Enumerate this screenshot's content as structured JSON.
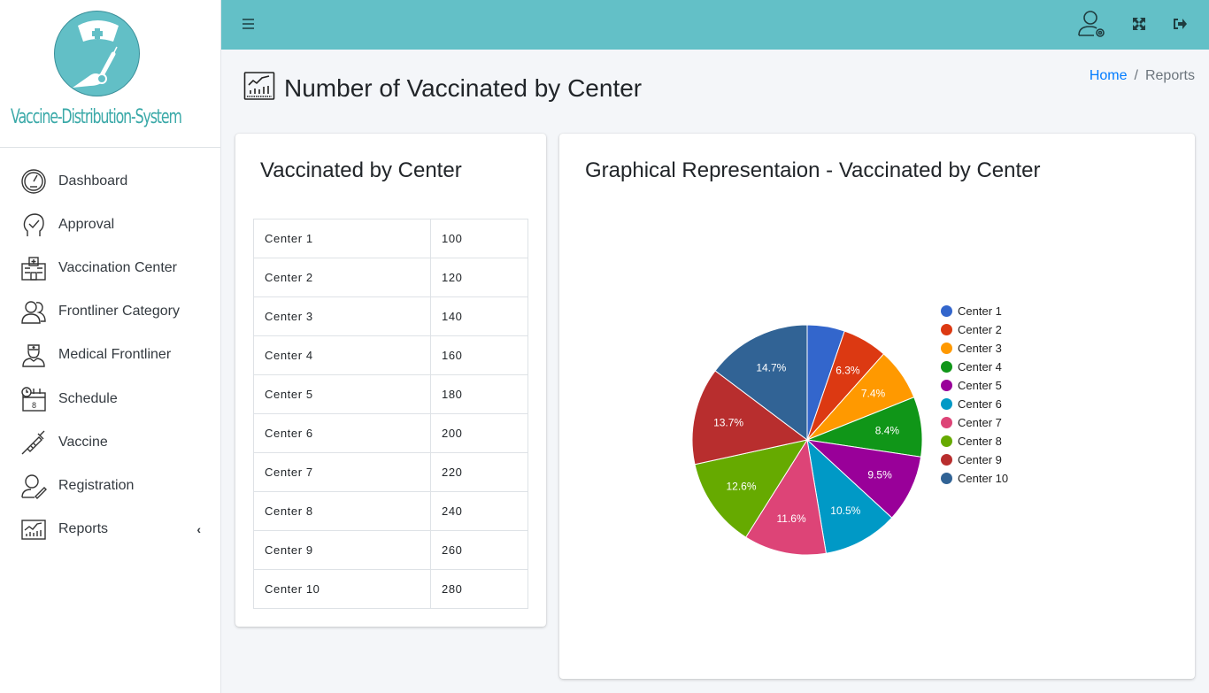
{
  "brand": {
    "name": "Vaccine-Distribution-System",
    "logo_icon": "nurse-syringe-logo-icon"
  },
  "sidebar": {
    "items": [
      {
        "label": "Dashboard",
        "icon": "speedometer-icon"
      },
      {
        "label": "Approval",
        "icon": "head-check-icon"
      },
      {
        "label": "Vaccination Center",
        "icon": "hospital-building-icon"
      },
      {
        "label": "Frontliner Category",
        "icon": "people-group-icon"
      },
      {
        "label": "Medical Frontliner",
        "icon": "nurse-icon"
      },
      {
        "label": "Schedule",
        "icon": "calendar-clock-icon"
      },
      {
        "label": "Vaccine",
        "icon": "syringe-icon"
      },
      {
        "label": "Registration",
        "icon": "user-edit-icon"
      },
      {
        "label": "Reports",
        "icon": "chart-report-icon",
        "caret": "‹"
      }
    ]
  },
  "topbar": {
    "menu_icon": "hamburger-icon",
    "user_icon": "user-settings-icon",
    "fullscreen_icon": "expand-icon",
    "logout_icon": "logout-icon"
  },
  "page": {
    "title": "Number of Vaccinated by Center",
    "title_icon": "chart-report-icon"
  },
  "breadcrumb": {
    "home": "Home",
    "separator": "/",
    "current": "Reports"
  },
  "table_card": {
    "title": "Vaccinated by Center",
    "rows": [
      {
        "name": "Center 1",
        "value": "100"
      },
      {
        "name": "Center 2",
        "value": "120"
      },
      {
        "name": "Center 3",
        "value": "140"
      },
      {
        "name": "Center 4",
        "value": "160"
      },
      {
        "name": "Center 5",
        "value": "180"
      },
      {
        "name": "Center 6",
        "value": "200"
      },
      {
        "name": "Center 7",
        "value": "220"
      },
      {
        "name": "Center 8",
        "value": "240"
      },
      {
        "name": "Center 9",
        "value": "260"
      },
      {
        "name": "Center 10",
        "value": "280"
      }
    ]
  },
  "chart_card": {
    "title": "Graphical Representaion - Vaccinated by Center"
  },
  "chart_data": {
    "type": "pie",
    "title": "Graphical Representaion - Vaccinated by Center",
    "categories": [
      "Center 1",
      "Center 2",
      "Center 3",
      "Center 4",
      "Center 5",
      "Center 6",
      "Center 7",
      "Center 8",
      "Center 9",
      "Center 10"
    ],
    "values": [
      100,
      120,
      140,
      160,
      180,
      200,
      220,
      240,
      260,
      280
    ],
    "slice_labels": [
      "",
      "6.3%",
      "7.4%",
      "8.4%",
      "9.5%",
      "10.5%",
      "11.6%",
      "12.6%",
      "13.7%",
      "14.7%"
    ],
    "colors": [
      "#3366cc",
      "#dc3912",
      "#ff9900",
      "#109618",
      "#990099",
      "#0099c6",
      "#dd4477",
      "#66aa00",
      "#b82e2e",
      "#316395"
    ],
    "legend_position": "right"
  },
  "colors": {
    "topbar": "#63c0c7",
    "brand_text": "#3aa9a8",
    "link": "#007bff"
  }
}
